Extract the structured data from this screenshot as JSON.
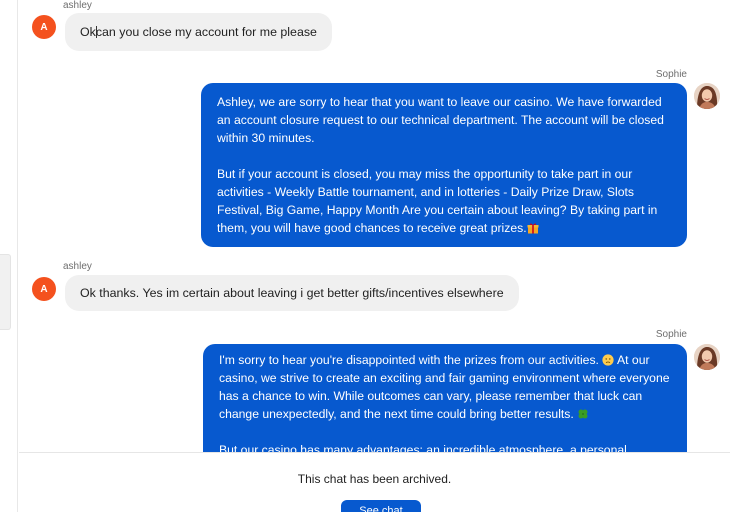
{
  "messages": [
    {
      "sender": "ashley",
      "avatar_letter": "A",
      "text_before_cursor": "Ok",
      "text_after_cursor": " can you close my account for me please"
    },
    {
      "sender": "Sophie",
      "paragraphs": [
        "Ashley, we are sorry to hear that you want to leave our casino. We have forwarded an account closure request to our technical department. The account will be closed within 30 minutes.",
        "But if your account is closed, you may miss the opportunity to take part in our activities - Weekly Battle tournament, and in lotteries - Daily Prize Draw, Slots Festival, Big Game, Happy Month Are you certain about leaving? By taking part in them, you will have good chances to receive great prizes."
      ],
      "emoji": "gift-emoji"
    },
    {
      "sender": "ashley",
      "avatar_letter": "A",
      "text": "Ok thanks. Yes im certain about leaving i get better gifts/incentives elsewhere"
    },
    {
      "sender": "Sophie",
      "paragraphs": [
        "I'm sorry to hear you're disappointed with the prizes from our activities.",
        "At our casino, we strive to create an exciting and fair gaming environment where everyone has a chance to win. While outcomes can vary, please remember that luck can change unexpectedly, and the next time could bring better results.",
        "But our casino has many advantages: an incredible atmosphere, a personal manager"
      ],
      "emojis": [
        "slightly-sad-emoji",
        "four-leaf-clover-emoji"
      ]
    }
  ],
  "footer": {
    "archived_text": "This chat has been archived.",
    "button_label": "See chat"
  },
  "colors": {
    "agent_bubble": "#0759cf",
    "user_bubble": "#f0f0f0",
    "user_avatar": "#f4511e"
  }
}
